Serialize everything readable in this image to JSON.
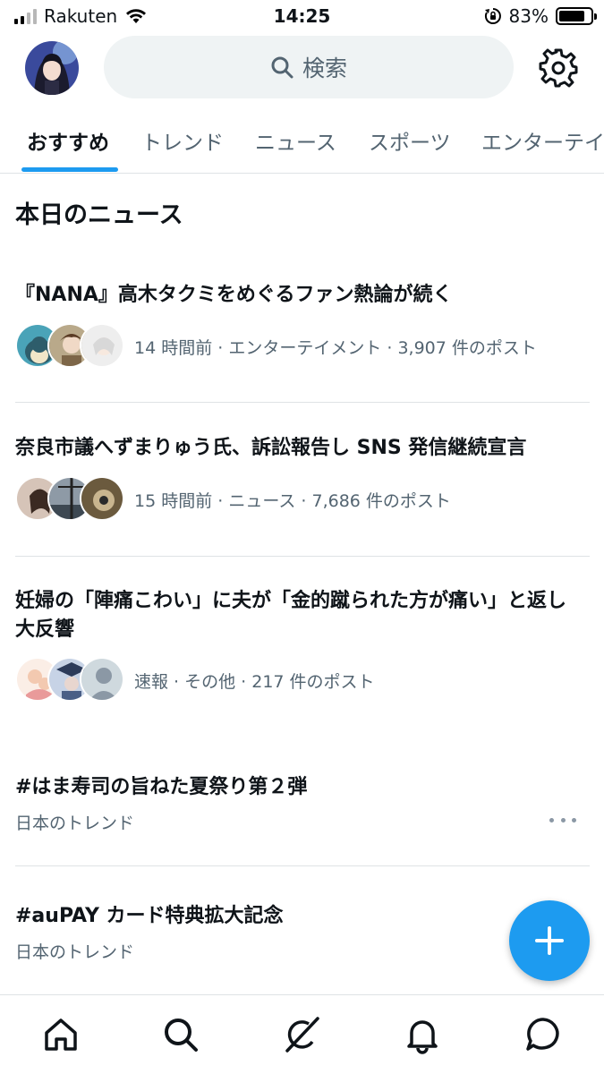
{
  "status": {
    "carrier": "Rakuten",
    "time": "14:25",
    "battery": "83%",
    "battery_level": 0.83
  },
  "header": {
    "search_placeholder": "検索"
  },
  "tabs": [
    {
      "label": "おすすめ"
    },
    {
      "label": "トレンド"
    },
    {
      "label": "ニュース"
    },
    {
      "label": "スポーツ"
    },
    {
      "label": "エンターテイ"
    }
  ],
  "section_title": "本日のニュース",
  "news": [
    {
      "title": "『NANA』高木タクミをめぐるファン熱論が続く",
      "meta": "14 時間前 · エンターテイメント · 3,907 件のポスト"
    },
    {
      "title": "奈良市議へずまりゅう氏、訴訟報告し SNS 発信継続宣言",
      "meta": "15 時間前 · ニュース · 7,686 件のポスト"
    },
    {
      "title_line1": "妊婦の「陣痛こわい」に夫が「金的蹴られた方が痛い」と返し",
      "title_line2": "大反響",
      "meta": "速報 · その他 · 217 件のポスト"
    }
  ],
  "trends": [
    {
      "title": "#はま寿司の旨ねた夏祭り第２弾",
      "sub": "日本のトレンド"
    },
    {
      "title": "#auPAY カード特典拡大記念",
      "sub": "日本のトレンド"
    }
  ],
  "colors": {
    "accent": "#1d9bf0",
    "secondary_text": "#536471",
    "divider": "#dfe3e5"
  },
  "icons": {
    "settings": "gear-icon",
    "search": "search-icon",
    "fab": "plus-icon",
    "nav": [
      "home-icon",
      "search-icon",
      "grok-icon",
      "bell-icon",
      "chat-icon"
    ]
  }
}
